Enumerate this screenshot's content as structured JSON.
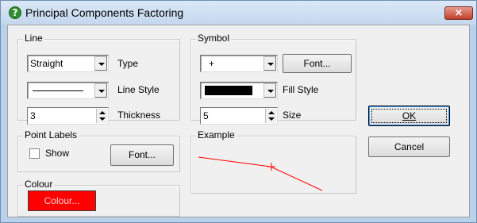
{
  "window": {
    "title": "Principal Components Factoring",
    "close_glyph": "×",
    "help_glyph": "?"
  },
  "line_group": {
    "label": "Line",
    "type_value": "Straight",
    "type_label": "Type",
    "style_label": "Line Style",
    "thickness_value": "3",
    "thickness_label": "Thickness"
  },
  "symbol_group": {
    "label": "Symbol",
    "symbol_value": "+",
    "font_button": "Font...",
    "fill_style_label": "Fill Style",
    "fill_color": "#000000",
    "size_value": "5",
    "size_label": "Size"
  },
  "point_labels_group": {
    "label": "Point Labels",
    "show_label": "Show",
    "show_checked": false,
    "font_button": "Font..."
  },
  "colour_group": {
    "label": "Colour",
    "button_label": "Colour...",
    "color": "#ff0000"
  },
  "example_group": {
    "label": "Example",
    "line_color": "#ff0000"
  },
  "buttons": {
    "ok": "OK",
    "cancel": "Cancel"
  }
}
